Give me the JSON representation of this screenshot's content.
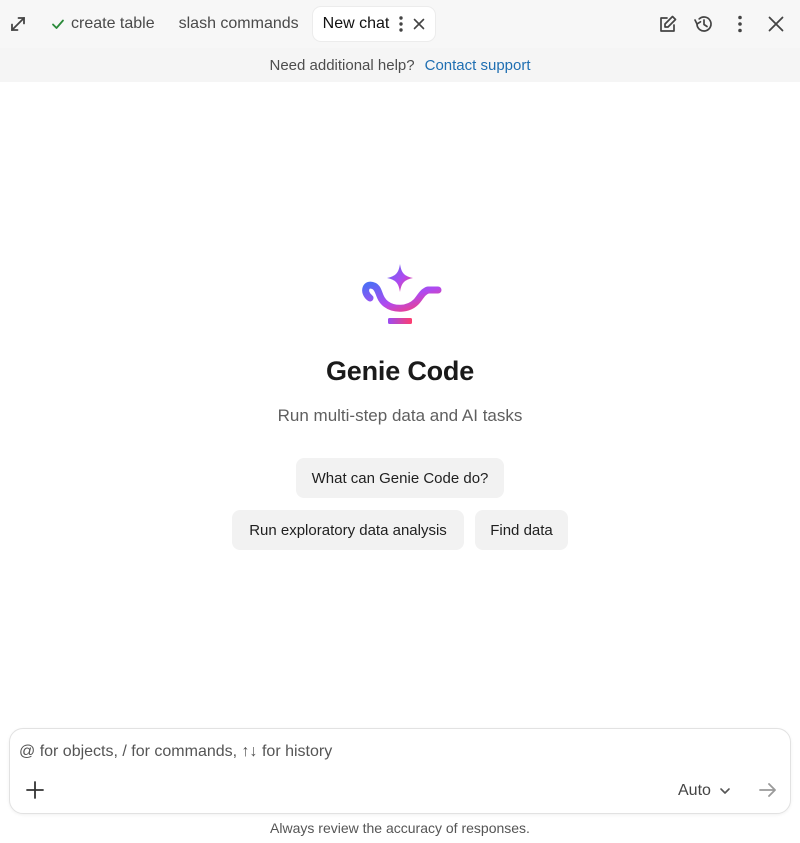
{
  "tabs": [
    {
      "label": "create table",
      "done": true
    },
    {
      "label": "slash commands"
    },
    {
      "label": "New chat",
      "active": true
    }
  ],
  "toolbar_icons": [
    "expand-icon",
    "compose-icon",
    "history-icon",
    "kebab-icon",
    "close-icon"
  ],
  "help": {
    "text": "Need additional help?",
    "link": "Contact support"
  },
  "hero": {
    "title": "Genie Code",
    "subtitle": "Run multi-step data and AI tasks"
  },
  "suggestions": [
    "What can Genie Code do?",
    "Run exploratory data analysis",
    "Find data"
  ],
  "composer": {
    "placeholder": "@ for objects, / for commands, ↑↓ for history",
    "value": "",
    "model": "Auto"
  },
  "disclaimer": "Always review the accuracy of responses.",
  "colors": {
    "link": "#1f6fb2",
    "check": "#2a8a3a",
    "logo_gradient": [
      "#4f6df5",
      "#b04af0",
      "#ff3d6e"
    ]
  }
}
